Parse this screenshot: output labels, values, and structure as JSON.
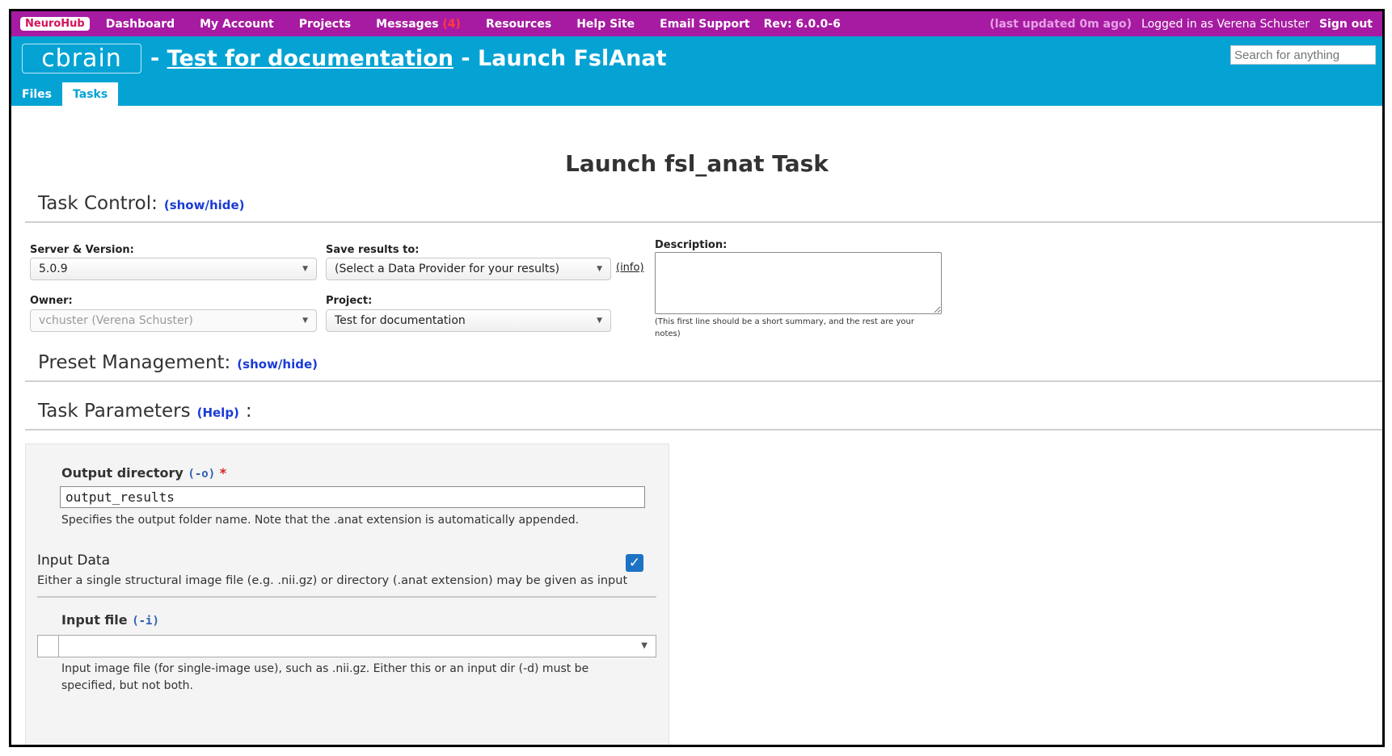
{
  "menu": {
    "brand": "NeuroHub",
    "items": [
      "Dashboard",
      "My Account",
      "Projects",
      "Messages",
      "Resources",
      "Help Site",
      "Email Support"
    ],
    "messages_count": "(4)",
    "rev": "Rev: 6.0.0-6",
    "last_updated": "(last updated 0m ago)",
    "logged_in": "Logged in as Verena Schuster",
    "sign_out": "Sign out"
  },
  "header": {
    "logo": "cbrain",
    "sep1": " - ",
    "project_link": "Test for documentation",
    "sep2": " - Launch FslAnat",
    "search_placeholder": "Search for anything",
    "tabs": [
      "Files",
      "Tasks"
    ],
    "active_tab": "Tasks"
  },
  "page": {
    "title": "Launch fsl_anat Task"
  },
  "task_control": {
    "heading": "Task Control:",
    "toggle": "(show/hide)",
    "server_label": "Server & Version:",
    "server_value": "5.0.9",
    "save_label": "Save results to:",
    "save_value": "(Select a Data Provider for your results)",
    "info": "(info)",
    "description_label": "Description:",
    "description_value": "",
    "description_hint": "(This first line should be a short summary, and the rest are your notes)",
    "owner_label": "Owner:",
    "owner_value": "vchuster (Verena Schuster)",
    "project_label": "Project:",
    "project_value": "Test for documentation"
  },
  "preset_management": {
    "heading": "Preset Management:",
    "toggle": "(show/hide)"
  },
  "task_parameters": {
    "heading": "Task Parameters",
    "help": "(Help)",
    "colon": ":",
    "output_dir_label": "Output directory",
    "output_dir_flag": "(-o)",
    "required_mark": "*",
    "output_dir_value": "output_results",
    "output_dir_hint": "Specifies the output folder name. Note that the .anat extension is automatically appended.",
    "input_data_heading": "Input Data",
    "input_data_checked": true,
    "input_data_desc": "Either a single structural image file (e.g. .nii.gz) or directory (.anat extension) may be given as input",
    "input_file_label": "Input file",
    "input_file_flag": "(-i)",
    "input_file_value": "",
    "input_file_hint": "Input image file (for single-image use), such as .nii.gz. Either this or an input dir (-d) must be specified, but not both."
  },
  "colors": {
    "menubar": "#a71ba2",
    "header": "#05a3d4",
    "link": "#1a3bd6",
    "checkbox": "#1c73c4"
  }
}
